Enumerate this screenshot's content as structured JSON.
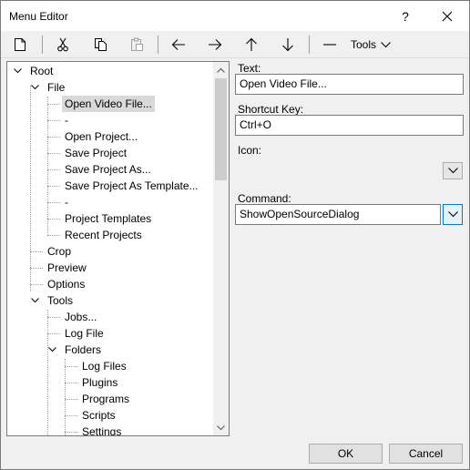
{
  "window": {
    "title": "Menu Editor",
    "help_label": "?"
  },
  "toolbar": {
    "items": [
      {
        "name": "new-icon"
      },
      {
        "name": "cut-icon"
      },
      {
        "name": "copy-icon"
      },
      {
        "name": "paste-icon"
      },
      {
        "name": "arrow-left-icon"
      },
      {
        "name": "arrow-right-icon"
      },
      {
        "name": "arrow-up-icon"
      },
      {
        "name": "arrow-down-icon"
      },
      {
        "name": "separator-item-icon"
      }
    ],
    "tools_label": "Tools"
  },
  "tree": {
    "root": "Root",
    "file": "File",
    "file_children": [
      "Open Video File...",
      "-",
      "Open Project...",
      "Save Project",
      "Save Project As...",
      "Save Project As Template...",
      "-",
      "Project Templates",
      "Recent Projects"
    ],
    "crop": "Crop",
    "preview": "Preview",
    "options": "Options",
    "tools": "Tools",
    "tools_children": [
      "Jobs...",
      "Log File"
    ],
    "folders": "Folders",
    "folders_children": [
      "Log Files",
      "Plugins",
      "Programs",
      "Scripts",
      "Settings"
    ],
    "selected": "Open Video File..."
  },
  "form": {
    "text_label": "Text:",
    "text_value": "Open Video File...",
    "shortcut_label": "Shortcut Key:",
    "shortcut_value": "Ctrl+O",
    "icon_label": "Icon:",
    "command_label": "Command:",
    "command_value": "ShowOpenSourceDialog"
  },
  "buttons": {
    "ok": "OK",
    "cancel": "Cancel"
  },
  "colors": {
    "selection": "#d9d9d9",
    "focus_border": "#0078d7"
  }
}
